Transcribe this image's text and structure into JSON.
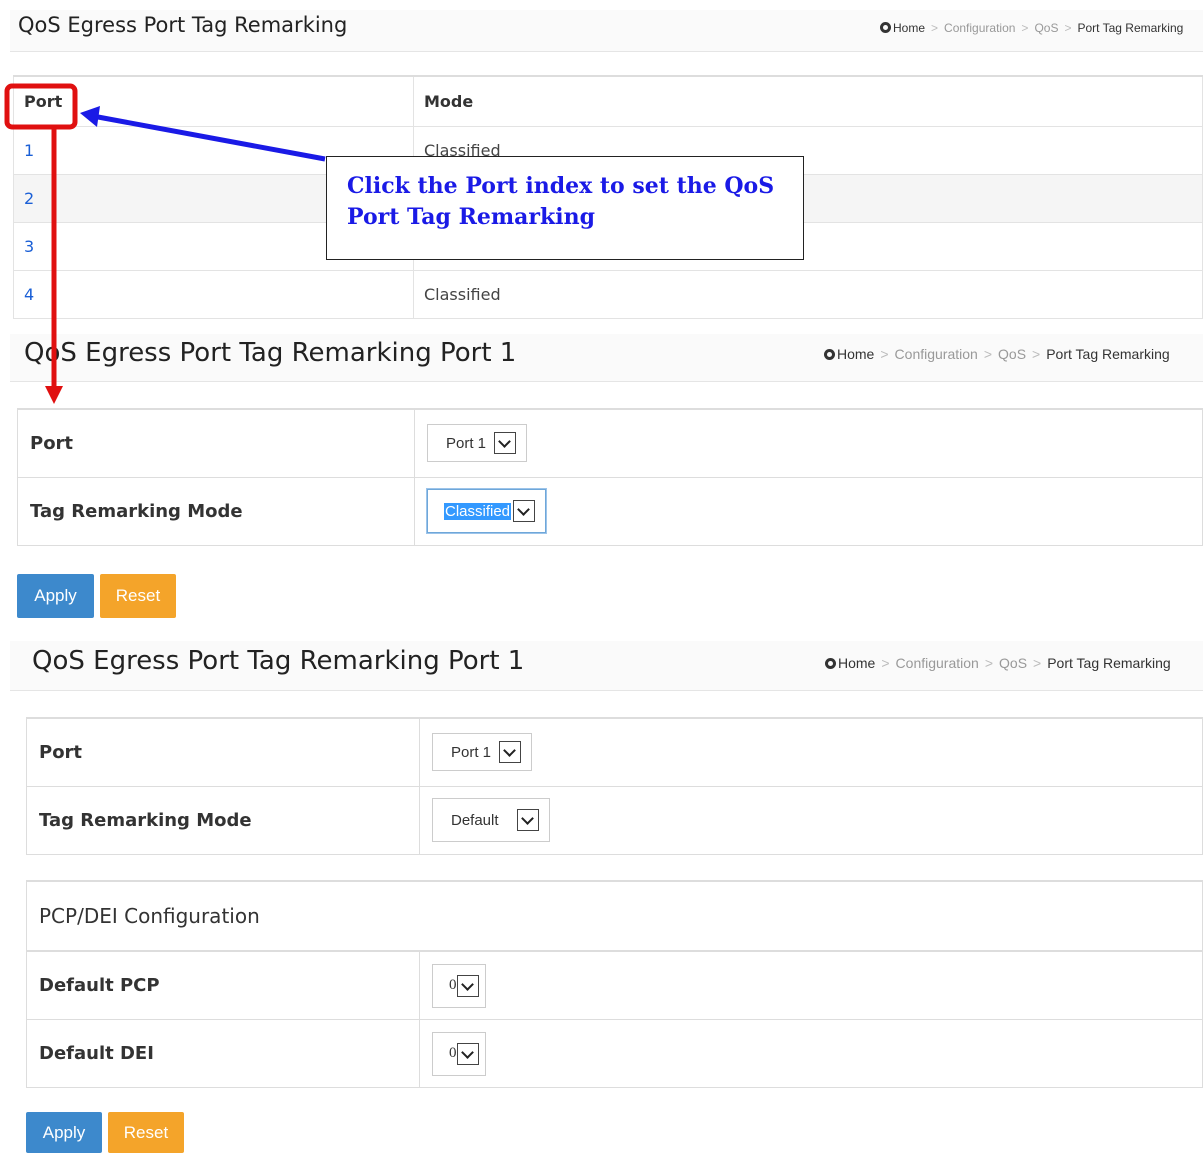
{
  "panel1": {
    "title": "QoS Egress Port Tag Remarking",
    "breadcrumb": {
      "home": "Home",
      "items": [
        "Configuration",
        "QoS"
      ],
      "current": "Port Tag Remarking"
    },
    "table": {
      "headers": [
        "Port",
        "Mode"
      ],
      "rows": [
        {
          "port": "1",
          "mode": "Classified"
        },
        {
          "port": "2",
          "mode": ""
        },
        {
          "port": "3",
          "mode": ""
        },
        {
          "port": "4",
          "mode": "Classified"
        }
      ]
    }
  },
  "callout": {
    "text": "Click the Port index to set the QoS Port Tag Remarking"
  },
  "panel2": {
    "title": "QoS Egress Port Tag Remarking  Port 1",
    "breadcrumb": {
      "home": "Home",
      "items": [
        "Configuration",
        "QoS"
      ],
      "current": "Port Tag Remarking"
    },
    "port_label": "Port",
    "port_value": "Port 1",
    "mode_label": "Tag Remarking Mode",
    "mode_value": "Classified",
    "apply_label": "Apply",
    "reset_label": "Reset"
  },
  "panel3": {
    "title": "QoS Egress Port Tag Remarking  Port 1",
    "breadcrumb": {
      "home": "Home",
      "items": [
        "Configuration",
        "QoS"
      ],
      "current": "Port Tag Remarking"
    },
    "port_label": "Port",
    "port_value": "Port 1",
    "mode_label": "Tag Remarking Mode",
    "mode_value": "Default",
    "pcp_section_title": "PCP/DEI Configuration",
    "default_pcp_label": "Default PCP",
    "default_pcp_value": "0",
    "default_dei_label": "Default DEI",
    "default_dei_value": "0",
    "apply_label": "Apply",
    "reset_label": "Reset"
  },
  "colors": {
    "link": "#1a5fd6",
    "apply_button": "#3d89cc",
    "reset_button": "#f4a42a",
    "annotation_red": "#e01010",
    "annotation_blue": "#1a1ae6"
  }
}
